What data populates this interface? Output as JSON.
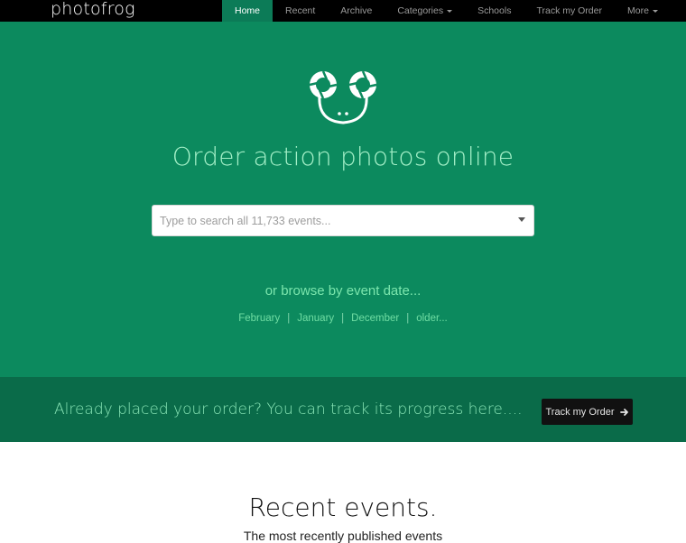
{
  "nav": {
    "brand": "photofrog",
    "items": [
      {
        "label": "Home",
        "active": true,
        "dropdown": false
      },
      {
        "label": "Recent",
        "active": false,
        "dropdown": false
      },
      {
        "label": "Archive",
        "active": false,
        "dropdown": false
      },
      {
        "label": "Categories",
        "active": false,
        "dropdown": true
      },
      {
        "label": "Schools",
        "active": false,
        "dropdown": false
      },
      {
        "label": "Track my Order",
        "active": false,
        "dropdown": false
      },
      {
        "label": "More",
        "active": false,
        "dropdown": true
      }
    ]
  },
  "hero": {
    "logo_icon": "frog-camera-logo-icon",
    "title": "Order action photos online",
    "search_placeholder": "Type to search all 11,733 events...",
    "browse_label": "or browse by event date...",
    "months": [
      "February",
      "January",
      "December",
      "older..."
    ]
  },
  "track": {
    "text": "Already placed your order? You can track its progress here....",
    "button_label": "Track my Order",
    "button_icon": "arrow-right-icon"
  },
  "recent": {
    "title": "Recent events.",
    "subtitle": "The most recently published events"
  },
  "colors": {
    "navbar": "#000000",
    "hero_bg": "#0c8a5e",
    "active_nav": "#0c7b57",
    "track_band": "#0a6b49",
    "accent_text": "#a4f0c8"
  }
}
